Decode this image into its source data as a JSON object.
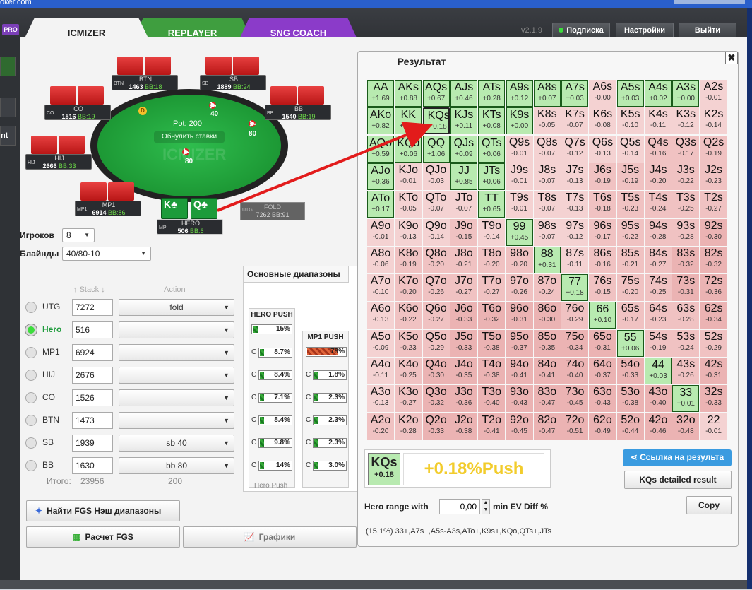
{
  "browser": {
    "url_fragment": "oker.com"
  },
  "header": {
    "pro_badge": "PRO",
    "tabs": [
      {
        "label": "ICMIZER"
      },
      {
        "label": "REPLAYER"
      },
      {
        "label": "SNG COACH"
      }
    ],
    "version": "v2.1.9",
    "subscribe_label": "Подписка",
    "settings_label": "Настройки",
    "logout_label": "Выйти"
  },
  "leftstrip": {
    "item_label": "nt"
  },
  "table": {
    "pot_label": "Pot: 200",
    "reset_label": "Обнулить ставки",
    "watermark": "ICMIZER",
    "dealer": "D",
    "bets": {
      "sb": "40",
      "bb": "80",
      "btn_area": "80"
    },
    "seats": [
      {
        "name": "BTN",
        "pos": "BTN",
        "stack": "1463",
        "bb": "BB:18"
      },
      {
        "name": "SB",
        "pos": "SB",
        "stack": "1889",
        "bb": "BB:24"
      },
      {
        "name": "CO",
        "pos": "CO",
        "stack": "1516",
        "bb": "BB:19"
      },
      {
        "name": "BB",
        "pos": "BB",
        "stack": "1540",
        "bb": "BB:19"
      },
      {
        "name": "HIJ",
        "pos": "HIJ",
        "stack": "2666",
        "bb": "BB:33"
      },
      {
        "name": "MP1",
        "pos": "MP1",
        "stack": "6914",
        "bb": "BB:86"
      },
      {
        "name": "HERO",
        "pos": "MP",
        "stack": "506",
        "bb": "BB:6"
      }
    ],
    "fold_seat": {
      "name": "FOLD",
      "pos": "UTG",
      "stack": "7262",
      "bb": "BB:91"
    },
    "hero_cards": [
      "K♣",
      "Q♣"
    ]
  },
  "settings": {
    "players_label": "Игроков",
    "players_value": "8",
    "blinds_label": "Блайнды",
    "blinds_value": "40/80-10"
  },
  "positions": {
    "stack_header": "Stack",
    "action_header": "Action",
    "rows": [
      {
        "pos": "UTG",
        "stack": "7272",
        "action": "fold"
      },
      {
        "pos": "Hero",
        "stack": "516",
        "action": ""
      },
      {
        "pos": "MP1",
        "stack": "6924",
        "action": ""
      },
      {
        "pos": "HIJ",
        "stack": "2676",
        "action": ""
      },
      {
        "pos": "CO",
        "stack": "1526",
        "action": ""
      },
      {
        "pos": "BTN",
        "stack": "1473",
        "action": ""
      },
      {
        "pos": "SB",
        "stack": "1939",
        "action": "sb 40"
      },
      {
        "pos": "BB",
        "stack": "1630",
        "action": "bb 80"
      }
    ],
    "total_label": "Итого:",
    "total_stack": "23956",
    "total_action": "200"
  },
  "buttons": {
    "find_fgs": "Найти FGS Нэш диапазоны",
    "calc_fgs": "Расчет FGS",
    "graphs": "Графики"
  },
  "ranges": {
    "tab_label": "Основные диапазоны",
    "footer": "Hero Push",
    "col1": {
      "title": "HERO PUSH",
      "top": {
        "pct": 15,
        "label": "15%"
      },
      "calls": [
        {
          "c": "C",
          "pct": 8.7,
          "label": "8.7%"
        },
        {
          "c": "C",
          "pct": 8.4,
          "label": "8.4%"
        },
        {
          "c": "C",
          "pct": 7.1,
          "label": "7.1%"
        },
        {
          "c": "C",
          "pct": 8.4,
          "label": "8.4%"
        },
        {
          "c": "C",
          "pct": 9.8,
          "label": "9.8%"
        },
        {
          "c": "C",
          "pct": 14,
          "label": "14%"
        }
      ]
    },
    "col2": {
      "title": "MP1 PUSH",
      "top": {
        "pct": 78,
        "label": "78%"
      },
      "calls": [
        {
          "c": "C",
          "pct": 1.8,
          "label": "1.8%"
        },
        {
          "c": "C",
          "pct": 2.3,
          "label": "2.3%"
        },
        {
          "c": "C",
          "pct": 2.3,
          "label": "2.3%"
        },
        {
          "c": "C",
          "pct": 2.3,
          "label": "2.3%"
        },
        {
          "c": "C",
          "pct": 3.0,
          "label": "3.0%"
        }
      ]
    }
  },
  "result": {
    "title": "Результат",
    "close": "✖",
    "grid": [
      [
        [
          "AA",
          "+1.69"
        ],
        [
          "AKs",
          "+0.88"
        ],
        [
          "AQs",
          "+0.67"
        ],
        [
          "AJs",
          "+0.46"
        ],
        [
          "ATs",
          "+0.28"
        ],
        [
          "A9s",
          "+0.12"
        ],
        [
          "A8s",
          "+0.07"
        ],
        [
          "A7s",
          "+0.03"
        ],
        [
          "A6s",
          "-0.00"
        ],
        [
          "A5s",
          "+0.03"
        ],
        [
          "A4s",
          "+0.02"
        ],
        [
          "A3s",
          "+0.00"
        ],
        [
          "A2s",
          "-0.01"
        ]
      ],
      [
        [
          "AKo",
          "+0.82"
        ],
        [
          "KK",
          "+1.29"
        ],
        [
          "KQs",
          "+0.18"
        ],
        [
          "KJs",
          "+0.11"
        ],
        [
          "KTs",
          "+0.08"
        ],
        [
          "K9s",
          "+0.00"
        ],
        [
          "K8s",
          "-0.05"
        ],
        [
          "K7s",
          "-0.07"
        ],
        [
          "K6s",
          "-0.08"
        ],
        [
          "K5s",
          "-0.10"
        ],
        [
          "K4s",
          "-0.11"
        ],
        [
          "K3s",
          "-0.12"
        ],
        [
          "K2s",
          "-0.14"
        ]
      ],
      [
        [
          "AQo",
          "+0.59"
        ],
        [
          "KQo",
          "+0.06"
        ],
        [
          "QQ",
          "+1.06"
        ],
        [
          "QJs",
          "+0.09"
        ],
        [
          "QTs",
          "+0.06"
        ],
        [
          "Q9s",
          "-0.01"
        ],
        [
          "Q8s",
          "-0.07"
        ],
        [
          "Q7s",
          "-0.12"
        ],
        [
          "Q6s",
          "-0.13"
        ],
        [
          "Q5s",
          "-0.14"
        ],
        [
          "Q4s",
          "-0.16"
        ],
        [
          "Q3s",
          "-0.17"
        ],
        [
          "Q2s",
          "-0.19"
        ]
      ],
      [
        [
          "AJo",
          "+0.36"
        ],
        [
          "KJo",
          "-0.01"
        ],
        [
          "QJo",
          "-0.03"
        ],
        [
          "JJ",
          "+0.85"
        ],
        [
          "JTs",
          "+0.06"
        ],
        [
          "J9s",
          "-0.01"
        ],
        [
          "J8s",
          "-0.07"
        ],
        [
          "J7s",
          "-0.13"
        ],
        [
          "J6s",
          "-0.19"
        ],
        [
          "J5s",
          "-0.19"
        ],
        [
          "J4s",
          "-0.20"
        ],
        [
          "J3s",
          "-0.22"
        ],
        [
          "J2s",
          "-0.23"
        ]
      ],
      [
        [
          "ATo",
          "+0.17"
        ],
        [
          "KTo",
          "-0.05"
        ],
        [
          "QTo",
          "-0.07"
        ],
        [
          "JTo",
          "-0.07"
        ],
        [
          "TT",
          "+0.65"
        ],
        [
          "T9s",
          "-0.01"
        ],
        [
          "T8s",
          "-0.07"
        ],
        [
          "T7s",
          "-0.13"
        ],
        [
          "T6s",
          "-0.18"
        ],
        [
          "T5s",
          "-0.23"
        ],
        [
          "T4s",
          "-0.24"
        ],
        [
          "T3s",
          "-0.25"
        ],
        [
          "T2s",
          "-0.27"
        ]
      ],
      [
        [
          "A9o",
          "-0.01"
        ],
        [
          "K9o",
          "-0.13"
        ],
        [
          "Q9o",
          "-0.14"
        ],
        [
          "J9o",
          "-0.15"
        ],
        [
          "T9o",
          "-0.14"
        ],
        [
          "99",
          "+0.45"
        ],
        [
          "98s",
          "-0.07"
        ],
        [
          "97s",
          "-0.12"
        ],
        [
          "96s",
          "-0.17"
        ],
        [
          "95s",
          "-0.22"
        ],
        [
          "94s",
          "-0.28"
        ],
        [
          "93s",
          "-0.28"
        ],
        [
          "92s",
          "-0.30"
        ]
      ],
      [
        [
          "A8o",
          "-0.06"
        ],
        [
          "K8o",
          "-0.19"
        ],
        [
          "Q8o",
          "-0.20"
        ],
        [
          "J8o",
          "-0.21"
        ],
        [
          "T8o",
          "-0.20"
        ],
        [
          "98o",
          "-0.20"
        ],
        [
          "88",
          "+0.31"
        ],
        [
          "87s",
          "-0.11"
        ],
        [
          "86s",
          "-0.16"
        ],
        [
          "85s",
          "-0.21"
        ],
        [
          "84s",
          "-0.27"
        ],
        [
          "83s",
          "-0.32"
        ],
        [
          "82s",
          "-0.32"
        ]
      ],
      [
        [
          "A7o",
          "-0.10"
        ],
        [
          "K7o",
          "-0.20"
        ],
        [
          "Q7o",
          "-0.26"
        ],
        [
          "J7o",
          "-0.27"
        ],
        [
          "T7o",
          "-0.27"
        ],
        [
          "97o",
          "-0.26"
        ],
        [
          "87o",
          "-0.24"
        ],
        [
          "77",
          "+0.18"
        ],
        [
          "76s",
          "-0.15"
        ],
        [
          "75s",
          "-0.20"
        ],
        [
          "74s",
          "-0.25"
        ],
        [
          "73s",
          "-0.31"
        ],
        [
          "72s",
          "-0.36"
        ]
      ],
      [
        [
          "A6o",
          "-0.13"
        ],
        [
          "K6o",
          "-0.22"
        ],
        [
          "Q6o",
          "-0.27"
        ],
        [
          "J6o",
          "-0.33"
        ],
        [
          "T6o",
          "-0.32"
        ],
        [
          "96o",
          "-0.31"
        ],
        [
          "86o",
          "-0.30"
        ],
        [
          "76o",
          "-0.29"
        ],
        [
          "66",
          "+0.10"
        ],
        [
          "65s",
          "-0.17"
        ],
        [
          "64s",
          "-0.23"
        ],
        [
          "63s",
          "-0.28"
        ],
        [
          "62s",
          "-0.34"
        ]
      ],
      [
        [
          "A5o",
          "-0.09"
        ],
        [
          "K5o",
          "-0.23"
        ],
        [
          "Q5o",
          "-0.29"
        ],
        [
          "J5o",
          "-0.33"
        ],
        [
          "T5o",
          "-0.38"
        ],
        [
          "95o",
          "-0.37"
        ],
        [
          "85o",
          "-0.35"
        ],
        [
          "75o",
          "-0.34"
        ],
        [
          "65o",
          "-0.31"
        ],
        [
          "55",
          "+0.06"
        ],
        [
          "54s",
          "-0.19"
        ],
        [
          "53s",
          "-0.24"
        ],
        [
          "52s",
          "-0.29"
        ]
      ],
      [
        [
          "A4o",
          "-0.11"
        ],
        [
          "K4o",
          "-0.25"
        ],
        [
          "Q4o",
          "-0.30"
        ],
        [
          "J4o",
          "-0.35"
        ],
        [
          "T4o",
          "-0.38"
        ],
        [
          "94o",
          "-0.41"
        ],
        [
          "84o",
          "-0.41"
        ],
        [
          "74o",
          "-0.40"
        ],
        [
          "64o",
          "-0.37"
        ],
        [
          "54o",
          "-0.33"
        ],
        [
          "44",
          "+0.03"
        ],
        [
          "43s",
          "-0.26"
        ],
        [
          "42s",
          "-0.31"
        ]
      ],
      [
        [
          "A3o",
          "-0.13"
        ],
        [
          "K3o",
          "-0.27"
        ],
        [
          "Q3o",
          "-0.32"
        ],
        [
          "J3o",
          "-0.36"
        ],
        [
          "T3o",
          "-0.40"
        ],
        [
          "93o",
          "-0.43"
        ],
        [
          "83o",
          "-0.47"
        ],
        [
          "73o",
          "-0.45"
        ],
        [
          "63o",
          "-0.43"
        ],
        [
          "53o",
          "-0.38"
        ],
        [
          "43o",
          "-0.40"
        ],
        [
          "33",
          "+0.01"
        ],
        [
          "32s",
          "-0.33"
        ]
      ],
      [
        [
          "A2o",
          "-0.20"
        ],
        [
          "K2o",
          "-0.28"
        ],
        [
          "Q2o",
          "-0.33"
        ],
        [
          "J2o",
          "-0.38"
        ],
        [
          "T2o",
          "-0.41"
        ],
        [
          "92o",
          "-0.45"
        ],
        [
          "82o",
          "-0.47"
        ],
        [
          "72o",
          "-0.51"
        ],
        [
          "62o",
          "-0.49"
        ],
        [
          "52o",
          "-0.44"
        ],
        [
          "42o",
          "-0.46"
        ],
        [
          "32o",
          "-0.48"
        ],
        [
          "22",
          "-0.01"
        ]
      ]
    ],
    "selected": {
      "hand": "KQs",
      "ev": "+0.18",
      "summary": "+0.18%Push"
    },
    "link_label": "Ссылка на результа",
    "detail_label": "KQs detailed result",
    "range_with_label": "Hero range with",
    "range_with_value": "0,00",
    "min_ev_label": "min EV Diff %",
    "copy_label": "Copy",
    "range_text": "(15,1%) 33+,A7s+,A5s-A3s,ATo+,K9s+,KQo,QTs+,JTs"
  }
}
